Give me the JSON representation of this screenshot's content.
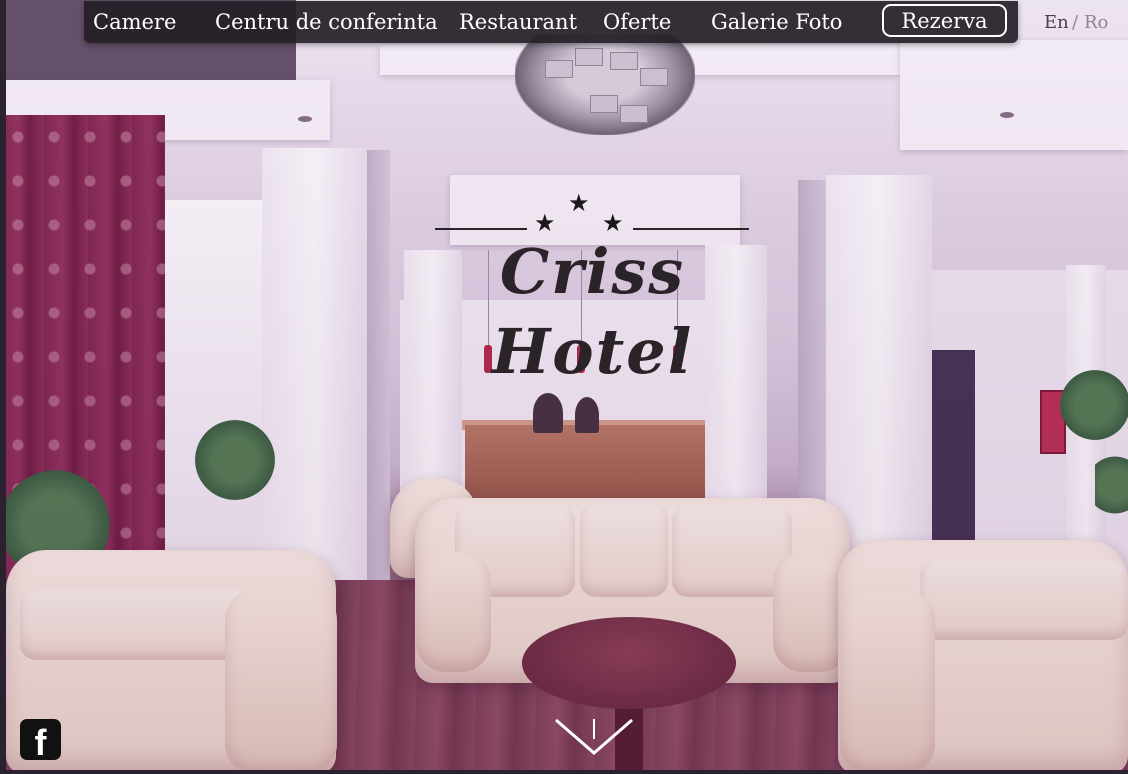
{
  "nav": {
    "items": [
      {
        "label": "Camere"
      },
      {
        "label": "Centru de conferinta"
      },
      {
        "label": "Restaurant"
      },
      {
        "label": "Oferte"
      },
      {
        "label": "Galerie Foto"
      }
    ],
    "reserve_label": "Rezerva"
  },
  "language": {
    "en": "En",
    "separator": "/",
    "ro": "Ro",
    "active": "En"
  },
  "logo": {
    "text": "Criss Hotel",
    "stars": 3,
    "star_glyph": "★"
  },
  "social": {
    "facebook_glyph": "f",
    "facebook_icon": "facebook-icon"
  },
  "scroll": {
    "icon": "chevron-down-icon"
  },
  "colors": {
    "nav_bg": "#241e26",
    "nav_text": "#ffffff",
    "logo_text": "#2a2328",
    "lang_active": "#4a3f4a",
    "lang_inactive": "#8d8590"
  }
}
